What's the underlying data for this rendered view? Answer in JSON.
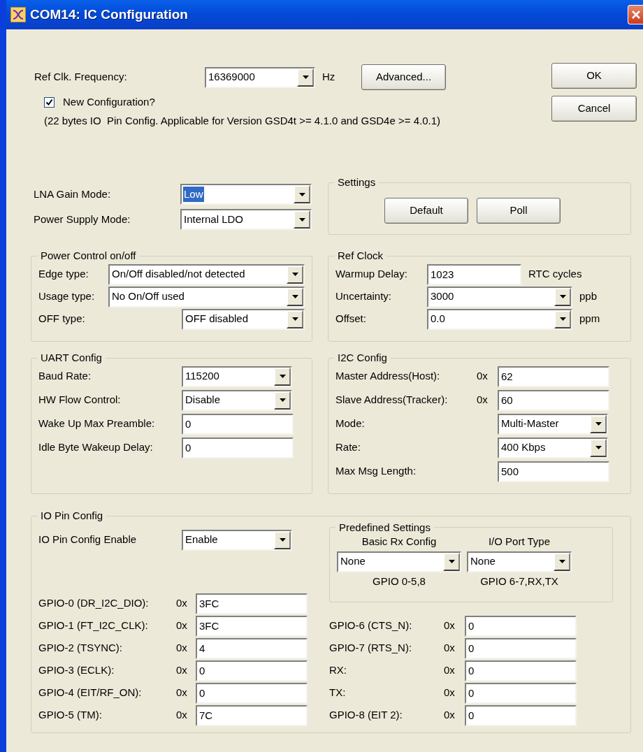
{
  "window": {
    "title": "COM14: IC Configuration"
  },
  "ref_clk": {
    "label": "Ref Clk. Frequency:",
    "value": "16369000",
    "unit": "Hz",
    "advanced_button": "Advanced..."
  },
  "dialog_buttons": [
    "OK",
    "Cancel"
  ],
  "new_configuration": {
    "label": "New Configuration?",
    "checked": true,
    "note": "(22 bytes IO  Pin Config. Applicable for Version GSD4t >= 4.1.0 and GSD4e >= 4.0.1)"
  },
  "general": [
    {
      "label": "LNA Gain Mode:",
      "value": "Low",
      "highlighted": true
    },
    {
      "label": "Power Supply Mode:",
      "value": "Internal LDO",
      "highlighted": false
    }
  ],
  "settings": {
    "title": "Settings",
    "buttons": [
      "Default",
      "Poll"
    ]
  },
  "power_control": {
    "title": "Power Control on/off",
    "rows": [
      {
        "label": "Edge type:",
        "kind": "wide-combo",
        "value": "On/Off disabled/not detected"
      },
      {
        "label": "Usage type:",
        "kind": "wide-combo",
        "value": "No On/Off used"
      },
      {
        "label": "OFF type:",
        "kind": "combo",
        "value": "OFF disabled"
      }
    ]
  },
  "ref_clock": {
    "title": "Ref Clock",
    "rows": [
      {
        "label": "Warmup Delay:",
        "kind": "text",
        "value": "1023",
        "unit": "RTC cycles"
      },
      {
        "label": "Uncertainty:",
        "kind": "combo",
        "value": "3000",
        "unit": "ppb"
      },
      {
        "label": "Offset:",
        "kind": "combo",
        "value": "0.0",
        "unit": "ppm"
      }
    ]
  },
  "uart_config": {
    "title": "UART Config",
    "rows": [
      {
        "label": "Baud Rate:",
        "kind": "combo",
        "value": "115200"
      },
      {
        "label": "HW Flow Control:",
        "kind": "combo",
        "value": "Disable"
      },
      {
        "label": "Wake Up Max Preamble:",
        "kind": "text",
        "value": "0"
      },
      {
        "label": "Idle Byte Wakeup Delay:",
        "kind": "text",
        "value": "0"
      }
    ]
  },
  "i2c_config": {
    "title": "I2C Config",
    "rows": [
      {
        "label": "Master Address(Host):",
        "kind": "text",
        "prefix": "0x",
        "value": "62"
      },
      {
        "label": "Slave Address(Tracker):",
        "kind": "text",
        "prefix": "0x",
        "value": "60"
      },
      {
        "label": "Mode:",
        "kind": "combo",
        "value": "Multi-Master"
      },
      {
        "label": "Rate:",
        "kind": "combo",
        "value": "400 Kbps"
      },
      {
        "label": "Max Msg Length:",
        "kind": "text",
        "value": "500"
      }
    ]
  },
  "io_pin_config": {
    "title": "IO Pin Config",
    "enable": {
      "label": "IO Pin Config Enable",
      "value": "Enable"
    },
    "predefined_settings": {
      "title": "Predefined Settings",
      "columns": [
        {
          "heading": "Basic Rx Config",
          "value": "None",
          "note": "GPIO 0-5,8"
        },
        {
          "heading": "I/O Port Type",
          "value": "None",
          "note": "GPIO 6-7,RX,TX"
        }
      ]
    },
    "gpio_left": [
      {
        "label": "GPIO-0 (DR_I2C_DIO):",
        "prefix": "0x",
        "value": "3FC"
      },
      {
        "label": "GPIO-1 (FT_I2C_CLK):",
        "prefix": "0x",
        "value": "3FC"
      },
      {
        "label": "GPIO-2 (TSYNC):",
        "prefix": "0x",
        "value": "4"
      },
      {
        "label": "GPIO-3 (ECLK):",
        "prefix": "0x",
        "value": "0"
      },
      {
        "label": "GPIO-4 (EIT/RF_ON):",
        "prefix": "0x",
        "value": "0"
      },
      {
        "label": "GPIO-5 (TM):",
        "prefix": "0x",
        "value": "7C"
      }
    ],
    "gpio_right": [
      {
        "label": "GPIO-6 (CTS_N):",
        "prefix": "0x",
        "value": "0"
      },
      {
        "label": "GPIO-7 (RTS_N):",
        "prefix": "0x",
        "value": "0"
      },
      {
        "label": "RX:",
        "prefix": "0x",
        "value": "0"
      },
      {
        "label": "TX:",
        "prefix": "0x",
        "value": "0"
      },
      {
        "label": "GPIO-8 (EIT 2):",
        "prefix": "0x",
        "value": "0"
      }
    ]
  }
}
